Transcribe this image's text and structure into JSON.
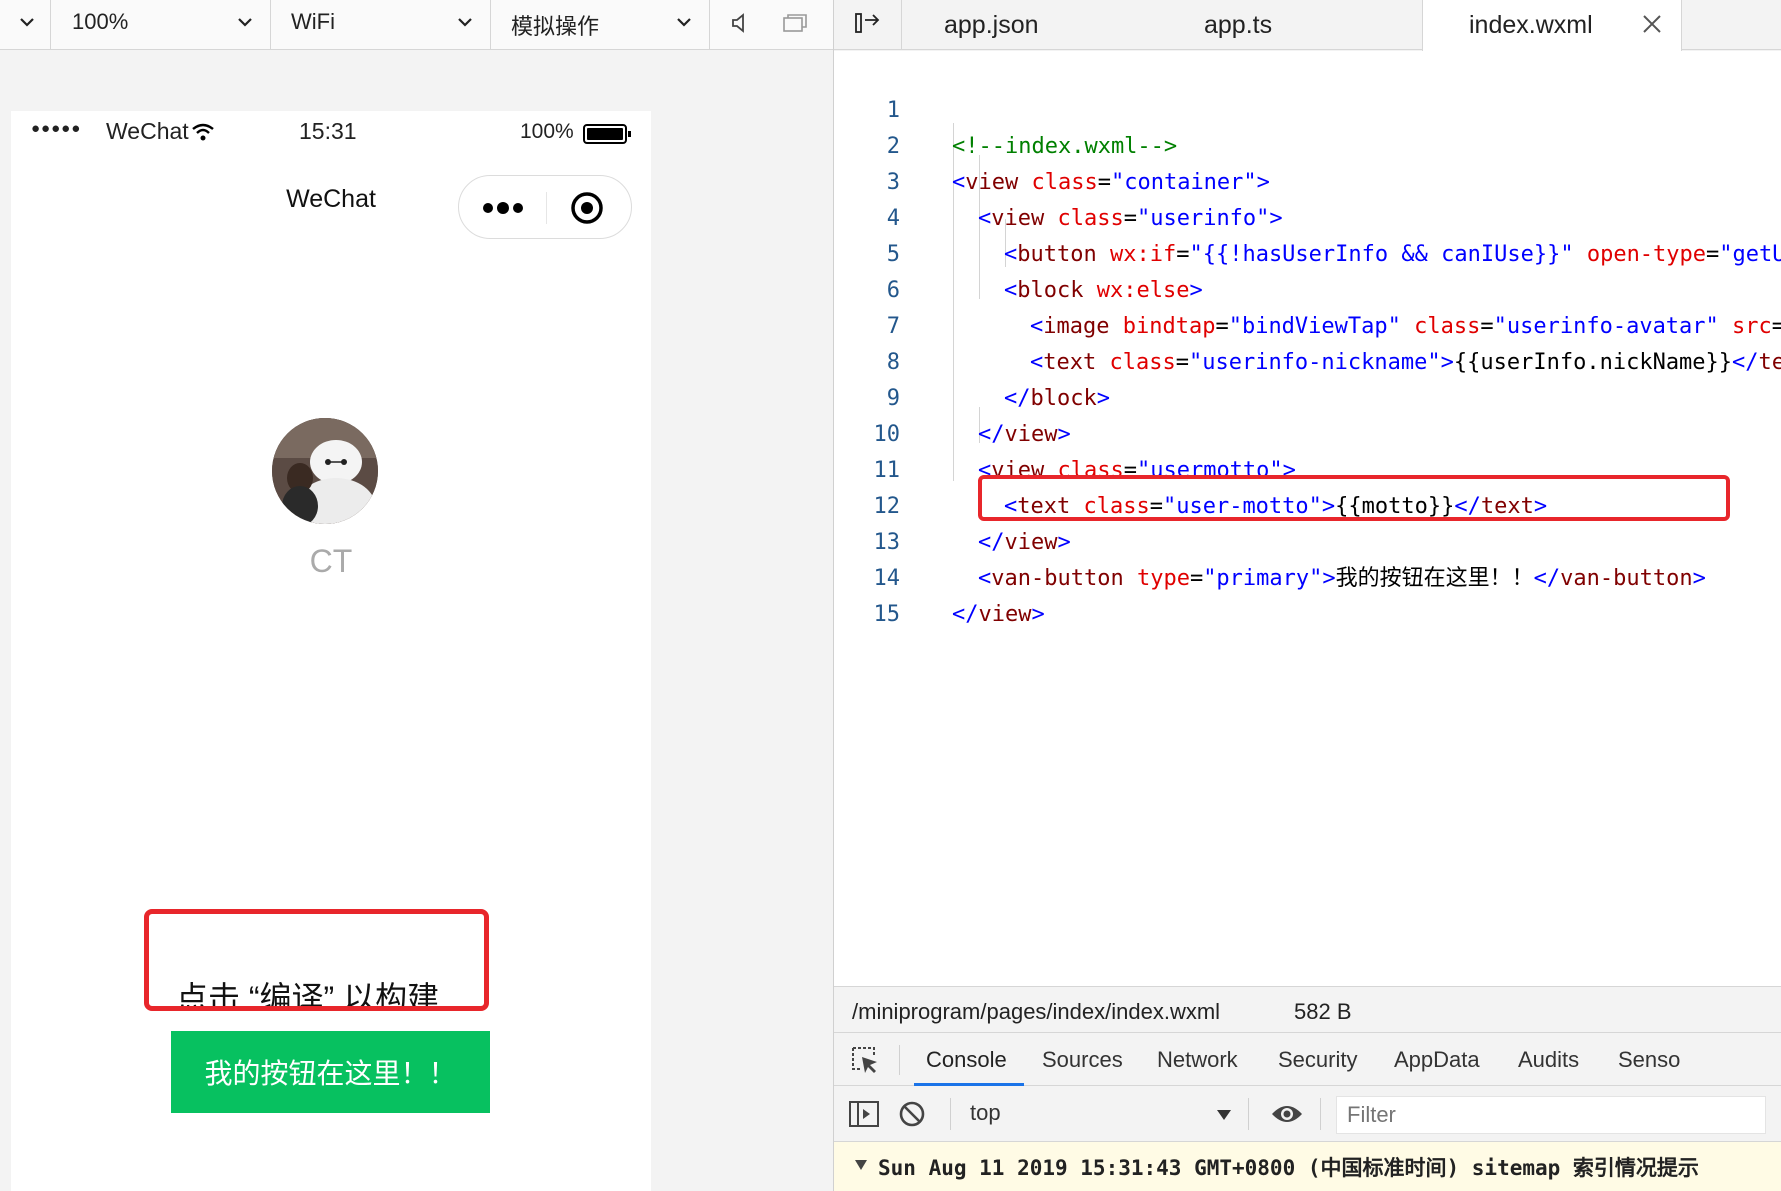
{
  "toolbar": {
    "zoom": "100%",
    "network": "WiFi",
    "operation": "模拟操作"
  },
  "phone": {
    "signal": "●●●●●",
    "carrier": "WeChat",
    "time": "15:31",
    "battery": "100%",
    "nav_title": "WeChat",
    "nickname": "CT",
    "hint": "点击 “编译” 以构建",
    "button_label": "我的按钮在这里！！"
  },
  "editor": {
    "tabs": [
      "app.json",
      "app.ts",
      "index.wxml"
    ],
    "active_tab": "index.wxml",
    "lines": [
      "<!--index.wxml-->",
      "<view class=\"container\">",
      "  <view class=\"userinfo\">",
      "    <button wx:if=\"{{!hasUserInfo && canIUse}}\" open-type=\"getU",
      "    <block wx:else>",
      "      <image bindtap=\"bindViewTap\" class=\"userinfo-avatar\" src=",
      "      <text class=\"userinfo-nickname\">{{userInfo.nickName}}</te",
      "    </block>",
      "  </view>",
      "  <view class=\"usermotto\">",
      "    <text class=\"user-motto\">{{motto}}</text>",
      "  </view>",
      "  <van-button type=\"primary\">我的按钮在这里！！</van-button>",
      "</view>",
      ""
    ]
  },
  "file_info": {
    "path": "/miniprogram/pages/index/index.wxml",
    "size": "582 B"
  },
  "devtools": {
    "tabs": [
      "Console",
      "Sources",
      "Network",
      "Security",
      "AppData",
      "Audits",
      "Senso"
    ],
    "active_tab": "Console",
    "context": "top",
    "filter_placeholder": "Filter",
    "log": "Sun Aug 11 2019 15:31:43 GMT+0800 (中国标准时间) sitemap 索引情况提示"
  },
  "colors": {
    "primary_button": "#07c160",
    "highlight": "#e8262b"
  }
}
